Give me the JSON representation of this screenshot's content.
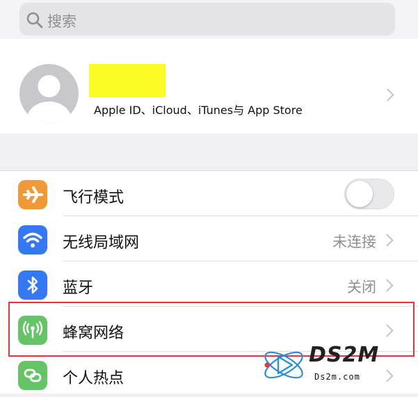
{
  "search": {
    "placeholder": "搜索"
  },
  "profile": {
    "subtitle": "Apple ID、iCloud、iTunes与 App Store"
  },
  "settings": {
    "rows": [
      {
        "label": "飞行模式",
        "icon": "airplane-icon",
        "color": "#f09a37",
        "toggle": false
      },
      {
        "label": "无线局域网",
        "value": "未连接",
        "icon": "wifi-icon",
        "color": "#3478f6"
      },
      {
        "label": "蓝牙",
        "value": "关闭",
        "icon": "bluetooth-icon",
        "color": "#3478f6"
      },
      {
        "label": "蜂窝网络",
        "icon": "antenna-icon",
        "color": "#65c466"
      },
      {
        "label": "个人热点",
        "icon": "hotspot-icon",
        "color": "#65c466"
      }
    ]
  },
  "watermark": {
    "text": "DS2M",
    "sub": "Ds2m.com"
  },
  "colors": {
    "highlight": "#e8323c",
    "placeholder_block": "#fbfb25"
  }
}
